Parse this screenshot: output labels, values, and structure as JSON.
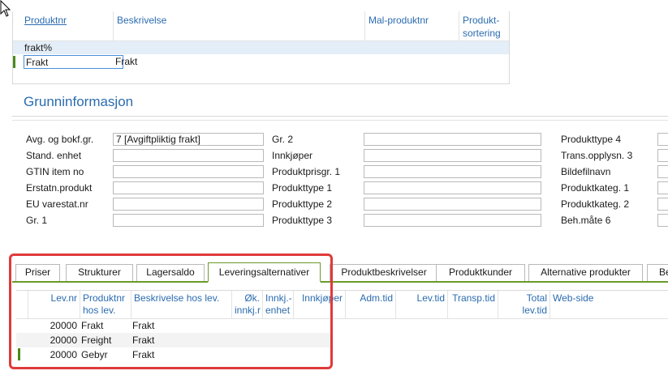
{
  "top_grid": {
    "columns": [
      "Produktnr",
      "Beskrivelse",
      "Mal-produktnr",
      "Produkt-\nsortering"
    ],
    "filter_value": "frakt%",
    "rows": [
      {
        "produktnr": "Frakt",
        "beskrivelse": "Frakt"
      }
    ]
  },
  "section_title": "Grunninformasjon",
  "form": {
    "col1": [
      {
        "label": "Avg. og bokf.gr.",
        "value": "7 [Avgiftpliktig frakt]"
      },
      {
        "label": "Stand. enhet",
        "value": ""
      },
      {
        "label": "GTIN item no",
        "value": ""
      },
      {
        "label": "Erstatn.produkt",
        "value": ""
      },
      {
        "label": "EU varestat.nr",
        "value": ""
      },
      {
        "label": "Gr. 1",
        "value": ""
      }
    ],
    "col2": [
      {
        "label": "Gr. 2",
        "value": ""
      },
      {
        "label": "Innkjøper",
        "value": ""
      },
      {
        "label": "Produktprisgr. 1",
        "value": ""
      },
      {
        "label": "Produkttype 1",
        "value": ""
      },
      {
        "label": "Produkttype 2",
        "value": ""
      },
      {
        "label": "Produkttype 3",
        "value": ""
      }
    ],
    "col3": [
      {
        "label": "Produkttype 4",
        "value": ""
      },
      {
        "label": "Trans.opplysn. 3",
        "value": ""
      },
      {
        "label": "Bildefilnavn",
        "value": ""
      },
      {
        "label": "Produktkateg. 1",
        "value": ""
      },
      {
        "label": "Produktkateg. 2",
        "value": ""
      },
      {
        "label": "Beh.måte 6",
        "value": ""
      }
    ]
  },
  "tabs": [
    "Priser",
    "Strukturer",
    "Lagersaldo",
    "Leveringsalternativer",
    "Produktbeskrivelser",
    "Produktkunder",
    "Alternative produkter",
    "Be"
  ],
  "active_tab": "Leveringsalternativer",
  "bottom_grid": {
    "columns": [
      "Lev.nr",
      "Produktnr\nhos lev.",
      "Beskrivelse hos lev.",
      "Øk.\ninnkj.r",
      "Innkj.-\nenhet",
      "Innkjøper",
      "Adm.tid",
      "Lev.tid",
      "Transp.tid",
      "Total\nlev.tid",
      "Web-side"
    ],
    "rows": [
      {
        "levnr": "20000",
        "produktnr": "Frakt",
        "beskrivelse": "Frakt"
      },
      {
        "levnr": "20000",
        "produktnr": "Freight",
        "beskrivelse": "Frakt"
      },
      {
        "levnr": "20000",
        "produktnr": "Gebyr",
        "beskrivelse": "Frakt"
      }
    ]
  },
  "colors": {
    "accent_blue": "#2b6cb0",
    "active_green": "#6a9a2a",
    "highlight_red": "#e03a3a",
    "filter_bg": "#e4eef8"
  }
}
